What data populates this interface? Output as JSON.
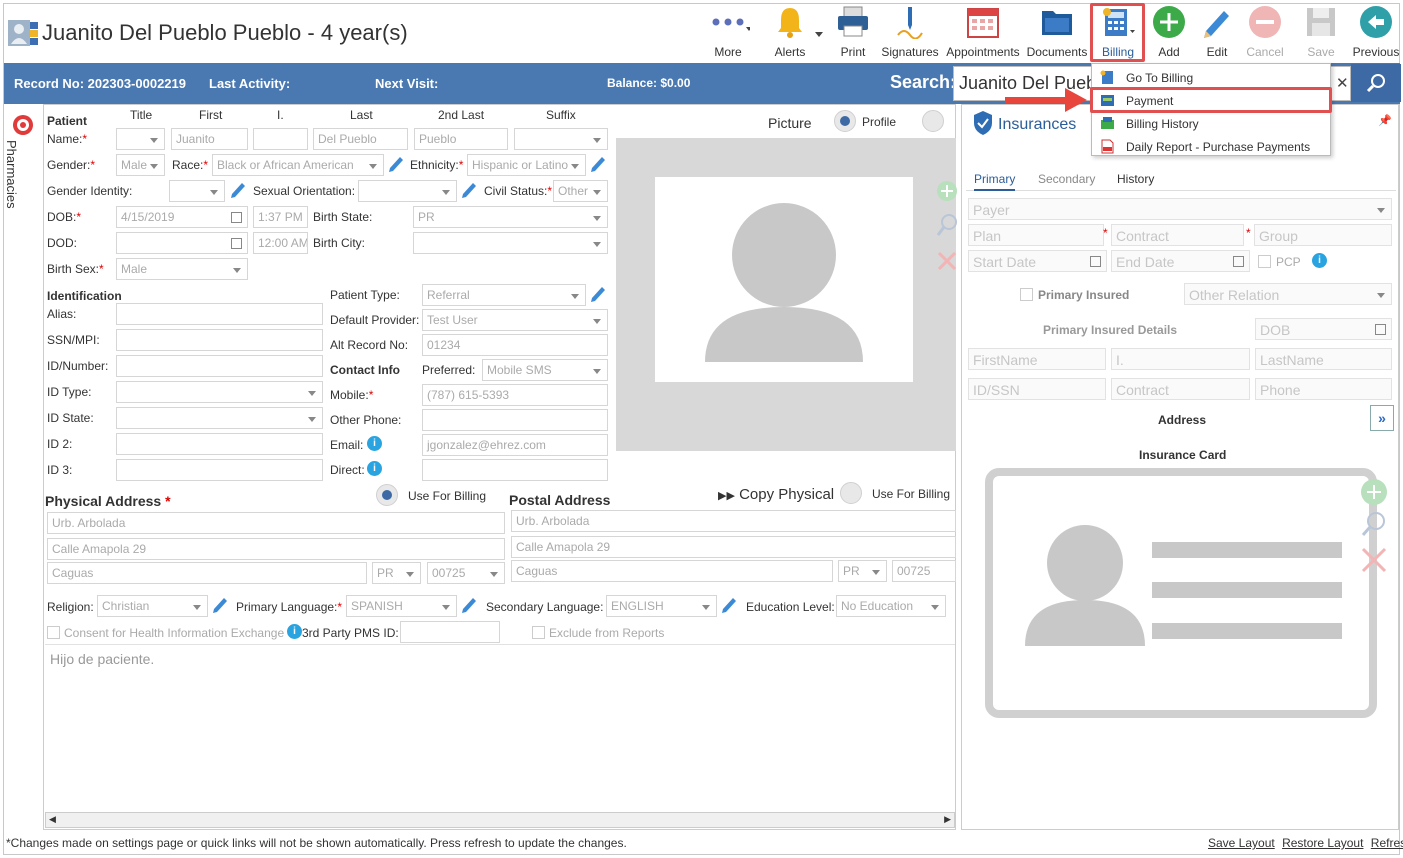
{
  "header": {
    "title": "Juanito Del Pueblo Pueblo - 4 year(s)"
  },
  "toolbar": {
    "more": "More",
    "alerts": "Alerts",
    "print": "Print",
    "signatures": "Signatures",
    "appointments": "Appointments",
    "documents": "Documents",
    "billing": "Billing",
    "add": "Add",
    "edit": "Edit",
    "cancel": "Cancel",
    "save": "Save",
    "previous": "Previous"
  },
  "bar": {
    "record": "Record No: 202303-0002219",
    "last_activity": "Last Activity:",
    "next_visit": "Next Visit:",
    "balance": "Balance: $0.00",
    "search_label": "Search:",
    "search_value": "Juanito Del Pueblo Pueblo"
  },
  "billing_menu": [
    "Go To Billing",
    "Payment",
    "Billing History",
    "Daily Report - Purchase Payments"
  ],
  "side_tab": "Pharmacies",
  "patient": {
    "section": "Patient",
    "cols": [
      "Title",
      "First",
      "I.",
      "Last",
      "2nd Last",
      "Suffix"
    ],
    "name_label": "Name:",
    "first": "Juanito",
    "last": "Del Pueblo",
    "second_last": "Pueblo",
    "gender_label": "Gender:",
    "gender": "Male",
    "race_label": "Race:",
    "race": "Black or African American",
    "ethnicity_label": "Ethnicity:",
    "ethnicity": "Hispanic or Latino",
    "gender_identity_label": "Gender Identity:",
    "sexual_orientation_label": "Sexual Orientation:",
    "civil_status_label": "Civil Status:",
    "civil_status": "Other",
    "dob_label": "DOB:",
    "dob": "4/15/2019",
    "dob_time": "1:37 PM",
    "birth_state_label": "Birth State:",
    "birth_state": "PR",
    "dod_label": "DOD:",
    "dod_time": "12:00 AM",
    "birth_city_label": "Birth City:",
    "birth_sex_label": "Birth Sex:",
    "birth_sex": "Male"
  },
  "identification": {
    "section": "Identification",
    "alias": "Alias:",
    "ssn": "SSN/MPI:",
    "id_number": "ID/Number:",
    "id_type": "ID Type:",
    "id_state": "ID State:",
    "id2": "ID 2:",
    "id3": "ID 3:"
  },
  "details": {
    "patient_type_label": "Patient Type:",
    "patient_type": "Referral",
    "default_provider_label": "Default Provider:",
    "default_provider": "Test User",
    "alt_record_label": "Alt Record No:",
    "alt_record": "01234",
    "contact_info": "Contact Info",
    "preferred_label": "Preferred:",
    "preferred": "Mobile SMS",
    "mobile_label": "Mobile:",
    "mobile": "(787) 615-5393",
    "other_phone_label": "Other Phone:",
    "email_label": "Email:",
    "email": "jgonzalez@ehrez.com",
    "direct_label": "Direct:"
  },
  "picture": {
    "label": "Picture",
    "profile": "Profile"
  },
  "physical": {
    "title": "Physical Address",
    "use_billing": "Use For Billing",
    "line1": "Urb. Arbolada",
    "line2": "Calle Amapola 29",
    "city": "Caguas",
    "state": "PR",
    "zip": "00725"
  },
  "postal": {
    "title": "Postal Address",
    "copy": "Copy Physical",
    "use_billing": "Use For Billing",
    "line1": "Urb. Arbolada",
    "line2": "Calle Amapola 29",
    "city": "Caguas",
    "state": "PR",
    "zip": "00725"
  },
  "misc": {
    "religion_label": "Religion:",
    "religion": "Christian",
    "primary_lang_label": "Primary Language:",
    "primary_lang": "SPANISH",
    "secondary_lang_label": "Secondary Language:",
    "secondary_lang": "ENGLISH",
    "education_label": "Education Level:",
    "education": "No Education",
    "consent": "Consent for Health Information Exchange",
    "third_party": "3rd Party PMS ID:",
    "exclude": "Exclude from Reports",
    "notes": "Hijo de paciente."
  },
  "insurances": {
    "title": "Insurances",
    "tabs": [
      "Primary",
      "Secondary",
      "History"
    ],
    "payer": "Payer",
    "plan": "Plan",
    "contract": "Contract",
    "group": "Group",
    "start": "Start Date",
    "end": "End Date",
    "pcp": "PCP",
    "primary_insured": "Primary Insured",
    "other_relation": "Other Relation",
    "details": "Primary Insured Details",
    "dob": "DOB",
    "first": "FirstName",
    "i": "I.",
    "last": "LastName",
    "idssn": "ID/SSN",
    "contract2": "Contract",
    "phone": "Phone",
    "address": "Address",
    "card": "Insurance Card"
  },
  "footer": {
    "note": "*Changes made on settings page or quick links will not be shown automatically. Press refresh to update the changes.",
    "save_layout": "Save Layout",
    "restore_layout": "Restore Layout",
    "refresh": "Refresh"
  },
  "colors": {
    "bar": "#4a78b0",
    "accent": "#2a5d9a",
    "highlight": "#e05050"
  }
}
